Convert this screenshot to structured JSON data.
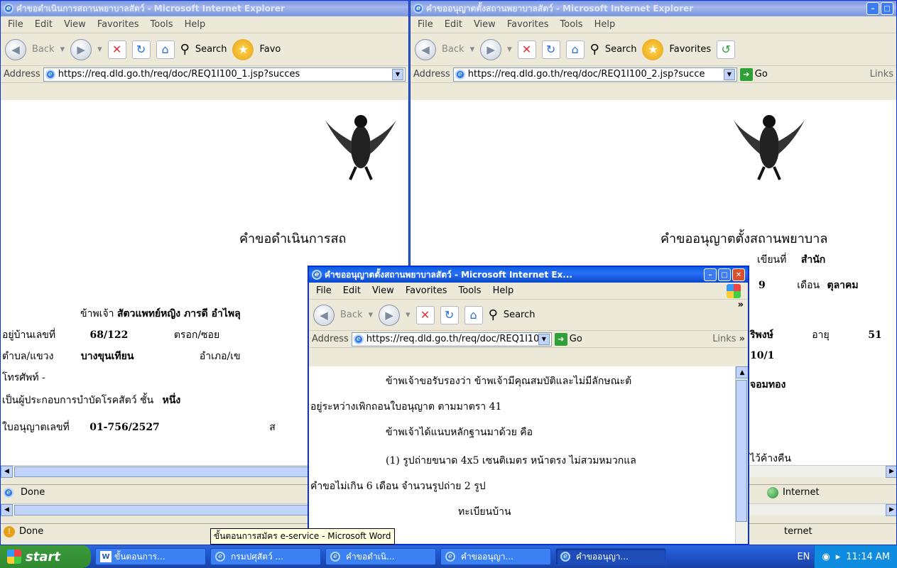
{
  "win1": {
    "title": "คำขอดำเนินการสถานพยาบาลสัตว์ - Microsoft Internet Explorer",
    "menus": [
      "File",
      "Edit",
      "View",
      "Favorites",
      "Tools",
      "Help"
    ],
    "back_label": "Back",
    "search_label": "Search",
    "favorites_label": "Favo",
    "address_label": "Address",
    "address_url": "https://req.dld.go.th/req/doc/REQ1I100_1.jsp?succes",
    "heading": "คำขอดำเนินการสถ",
    "line1_pre": "ข้าพเจ้า",
    "line1_name": "สัตวแพทย์หญิง ภารดี อำไพลุ",
    "line2_label": "อยู่บ้านเลขที่",
    "line2_value": "68/122",
    "line2_label2": "ตรอก/ซอย",
    "line3_label": "ตำบล/แขวง",
    "line3_value": "บางขุนเทียน",
    "line3_label2": "อำเภอ/เข",
    "line4": "โทรศัพท์ -",
    "line5_label": "เป็นผู้ประกอบการบำบัดโรคสัตว์ ชั้น",
    "line5_value": "หนึ่ง",
    "line6_label": "ใบอนุญาตเลขที่",
    "line6_value": "01-756/2527",
    "line6_tail": "ส",
    "status": "Done"
  },
  "win2": {
    "title": "คำขออนุญาตตั้งสถานพยาบาลสัตว์ - Microsoft Internet Explorer",
    "menus": [
      "File",
      "Edit",
      "View",
      "Favorites",
      "Tools",
      "Help"
    ],
    "back_label": "Back",
    "search_label": "Search",
    "favorites_label": "Favorites",
    "address_label": "Address",
    "address_url": "https://req.dld.go.th/req/doc/REQ1I100_2.jsp?succe",
    "go_label": "Go",
    "links_label": "Links",
    "heading": "คำขออนุญาตตั้งสถานพยาบาล",
    "written_at_label": "เขียนที่",
    "written_at_value": "สำนัก",
    "day_value": "9",
    "month_label": "เดือน",
    "month_value": "ตุลาคม",
    "profession_tail": "ริพงษ์",
    "age_label": "อายุ",
    "age_value": "51",
    "house_tail": "10/1",
    "district_tail": "จอมทอง",
    "overnight_tail": "ไว้ค้างคืน",
    "status": "Internet"
  },
  "back_window": {
    "status": "Done",
    "status_right": "ternet"
  },
  "popup": {
    "title": "คำขออนุญาตตั้งสถานพยาบาลสัตว์ - Microsoft Internet Ex...",
    "menus": [
      "File",
      "Edit",
      "View",
      "Favorites",
      "Tools",
      "Help"
    ],
    "back_label": "Back",
    "search_label": "Search",
    "address_label": "Address",
    "address_url": "https://req.dld.go.th/req/doc/REQ1I100",
    "go_label": "Go",
    "links_label": "Links",
    "para1": "ข้าพเจ้าขอรับรองว่า ข้าพเจ้ามีคุณสมบัติและไม่มีลักษณะต้",
    "para1b": "อยู่ระหว่างเพิกถอนใบอนุญาต ตามมาตรา 41",
    "para2": "ข้าพเจ้าได้แนบหลักฐานมาด้วย คือ",
    "para3": "(1) รูปถ่ายขนาด 4x5 เซนติเมตร หน้าตรง ไม่สวมหมวกแล",
    "para3b": "คำขอไม่เกิน 6 เดือน จำนวนรูปถ่าย 2 รูป",
    "para4_tail": "ทะเบียนบ้าน"
  },
  "tooltip": "ขั้นตอนการสมัคร e-service - Microsoft Word",
  "taskbar": {
    "start_label": "start",
    "tasks": [
      "ขั้นตอนการ...",
      "กรมปศุสัตว์ ...",
      "คำขอดำเนิ...",
      "คำขออนุญา...",
      "คำขออนุญา..."
    ],
    "lang": "EN",
    "clock": "11:14 AM"
  }
}
